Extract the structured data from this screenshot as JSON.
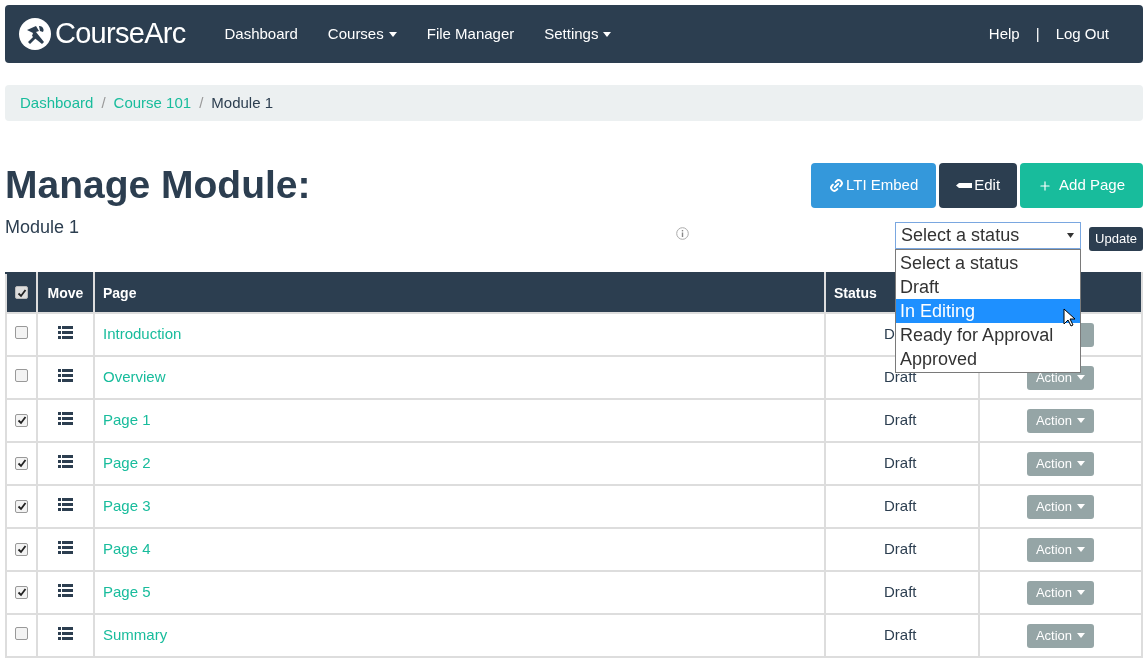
{
  "navbar": {
    "brand": "**Course**Arc",
    "items": [
      {
        "label": "Dashboard",
        "dropdown": false
      },
      {
        "label": "Courses",
        "dropdown": true
      },
      {
        "label": "File Manager",
        "dropdown": false
      },
      {
        "label": "Settings",
        "dropdown": true
      }
    ],
    "separator": "|",
    "right": [
      {
        "label": "Help"
      },
      {
        "label": "Log Out"
      }
    ]
  },
  "breadcrumb_separator": "/",
  "breadcrumb": [
    {
      "label": "Dashboard",
      "link": true
    },
    {
      "label": "Course 101",
      "link": true
    },
    {
      "label": "Module 1",
      "link": false
    }
  ],
  "title": "Manage Module:",
  "subtitle": "Module 1",
  "buttons": [
    {
      "label": "LTI Embed",
      "kind": "lti"
    },
    {
      "label": "Edit",
      "kind": "edit"
    },
    {
      "label": "Add Page",
      "kind": "add"
    }
  ],
  "status_select": {
    "value": "Select a status",
    "expanded": true,
    "options": [
      {
        "label": "Select a status",
        "highlighted": false
      },
      {
        "label": "Draft",
        "highlighted": false
      },
      {
        "label": "In Editing",
        "highlighted": true
      },
      {
        "label": "Ready for Approval",
        "highlighted": false
      },
      {
        "label": "Approved",
        "highlighted": false
      }
    ]
  },
  "update_button": "Update",
  "table": {
    "header_checked": true,
    "columns": [
      "Move",
      "Page",
      "Status"
    ],
    "rows": [
      {
        "checked": false,
        "page": "Introduction",
        "status": "D"
      },
      {
        "checked": false,
        "page": "Overview",
        "status": "Draft",
        "action": "Action"
      },
      {
        "checked": true,
        "page": "Page 1",
        "status": "Draft",
        "action": "Action"
      },
      {
        "checked": true,
        "page": "Page 2",
        "status": "Draft",
        "action": "Action"
      },
      {
        "checked": true,
        "page": "Page 3",
        "status": "Draft",
        "action": "Action"
      },
      {
        "checked": true,
        "page": "Page 4",
        "status": "Draft",
        "action": "Action"
      },
      {
        "checked": true,
        "page": "Page 5",
        "status": "Draft",
        "action": "Action"
      },
      {
        "checked": false,
        "page": "Summary",
        "status": "Draft",
        "action": "Action"
      }
    ]
  }
}
